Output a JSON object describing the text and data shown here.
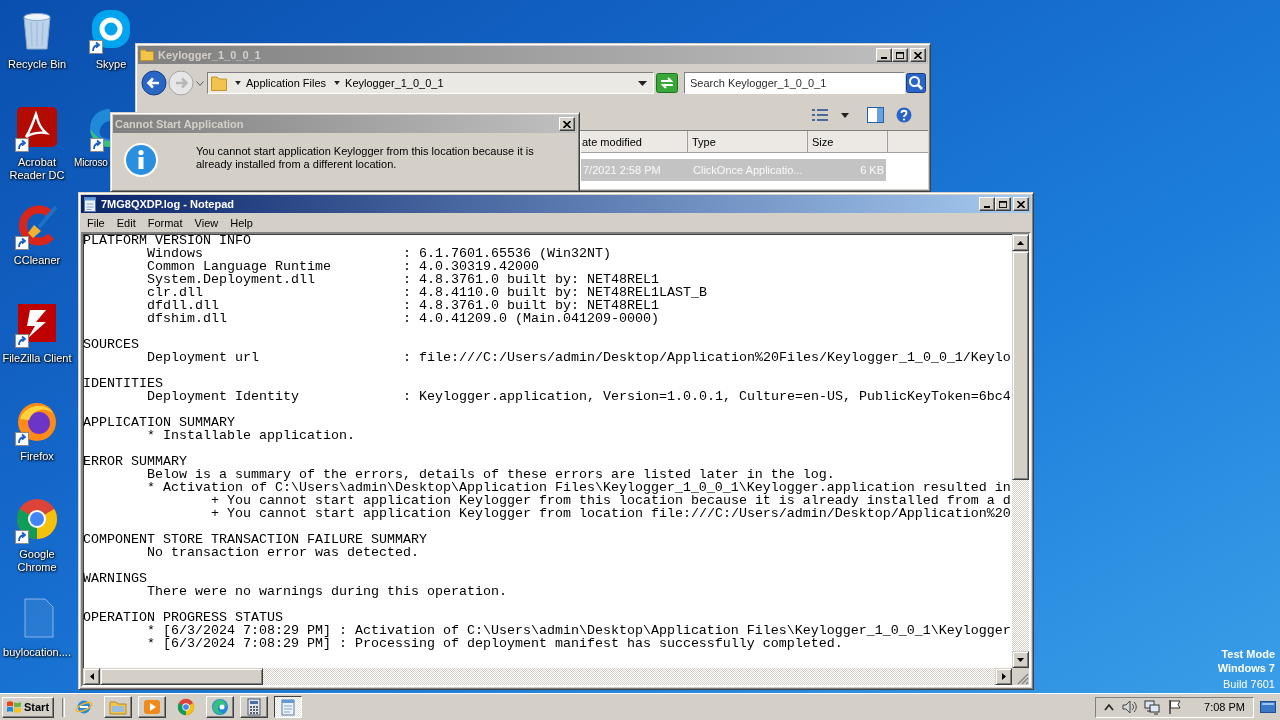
{
  "desktop_icons": [
    {
      "label": "Recycle Bin",
      "shortcut": false
    },
    {
      "label": "Acrobat Reader DC",
      "shortcut": true
    },
    {
      "label": "CCleaner",
      "shortcut": true
    },
    {
      "label": "FileZilla Client",
      "shortcut": true
    },
    {
      "label": "Firefox",
      "shortcut": true
    },
    {
      "label": "Google Chrome",
      "shortcut": true
    },
    {
      "label": "buylocation....",
      "shortcut": false
    },
    {
      "label": "Skype",
      "shortcut": true
    },
    {
      "label": "Microso",
      "shortcut": true
    }
  ],
  "explorer": {
    "title": "Keylogger_1_0_0_1",
    "active": false,
    "breadcrumb": [
      "Application Files",
      "Keylogger_1_0_0_1"
    ],
    "search": {
      "placeholder": "Search Keylogger_1_0_0_1"
    },
    "columns": [
      "ate modified",
      "Type",
      "Size"
    ],
    "rows": [
      {
        "cells": [
          "7/2021 2:58 PM",
          "ClickOnce Applicatio...",
          "6 KB"
        ],
        "selected": true
      }
    ]
  },
  "dialog": {
    "title": "Cannot Start Application",
    "active": false,
    "message": "You cannot start application Keylogger from this location because it is already installed from a different location."
  },
  "notepad": {
    "title": "7MG8QXDP.log - Notepad",
    "active": true,
    "menu": [
      "File",
      "Edit",
      "Format",
      "View",
      "Help"
    ],
    "log": [
      {
        "heading": "PLATFORM VERSION INFO",
        "lines": [
          {
            "kind": "field",
            "label": "Windows",
            "value": ": 6.1.7601.65536 (Win32NT)"
          },
          {
            "kind": "field",
            "label": "Common Language Runtime",
            "value": ": 4.0.30319.42000"
          },
          {
            "kind": "field",
            "label": "System.Deployment.dll",
            "value": ": 4.8.3761.0 built by: NET48REL1"
          },
          {
            "kind": "field",
            "label": "clr.dll",
            "value": ": 4.8.4110.0 built by: NET48REL1LAST_B"
          },
          {
            "kind": "field",
            "label": "dfdll.dll",
            "value": ": 4.8.3761.0 built by: NET48REL1"
          },
          {
            "kind": "field",
            "label": "dfshim.dll",
            "value": ": 4.0.41209.0 (Main.041209-0000)"
          }
        ]
      },
      {
        "heading": "SOURCES",
        "lines": [
          {
            "kind": "field",
            "label": "Deployment url",
            "value": ": file:///C:/Users/admin/Desktop/Application%20Files/Keylogger_1_0_0_1/Keylo"
          }
        ]
      },
      {
        "heading": "IDENTITIES",
        "lines": [
          {
            "kind": "field",
            "label": "Deployment Identity",
            "value": ": Keylogger.application, Version=1.0.0.1, Culture=en-US, PublicKeyToken=6bc4"
          }
        ]
      },
      {
        "heading": "APPLICATION SUMMARY",
        "lines": [
          {
            "kind": "text",
            "text": "* Installable application."
          }
        ]
      },
      {
        "heading": "ERROR SUMMARY",
        "lines": [
          {
            "kind": "text",
            "text": "Below is a summary of the errors, details of these errors are listed later in the log."
          },
          {
            "kind": "text",
            "text": "* Activation of C:\\Users\\admin\\Desktop\\Application Files\\Keylogger_1_0_0_1\\Keylogger.application resulted in",
            "children": [
              {
                "text": "+ You cannot start application Keylogger from this location because it is already installed from a d"
              },
              {
                "text": "+ You cannot start application Keylogger from location file:///C:/Users/admin/Desktop/Application%20"
              }
            ]
          }
        ]
      },
      {
        "heading": "COMPONENT STORE TRANSACTION FAILURE SUMMARY",
        "lines": [
          {
            "kind": "text",
            "text": "No transaction error was detected."
          }
        ]
      },
      {
        "heading": "WARNINGS",
        "lines": [
          {
            "kind": "text",
            "text": "There were no warnings during this operation."
          }
        ]
      },
      {
        "heading": "OPERATION PROGRESS STATUS",
        "lines": [
          {
            "kind": "text",
            "text": "* [6/3/2024 7:08:29 PM] : Activation of C:\\Users\\admin\\Desktop\\Application Files\\Keylogger_1_0_0_1\\Keylogger"
          },
          {
            "kind": "text",
            "text": "* [6/3/2024 7:08:29 PM] : Processing of deployment manifest has successfully completed."
          }
        ]
      }
    ]
  },
  "desktop_notice": [
    "Test Mode",
    "Windows 7",
    "Build 7601"
  ],
  "taskbar": {
    "start": "Start",
    "items": [
      {
        "open": false,
        "selected": false
      },
      {
        "open": true,
        "selected": false
      },
      {
        "open": true,
        "selected": false
      },
      {
        "open": false,
        "selected": false
      },
      {
        "open": true,
        "selected": false
      },
      {
        "open": true,
        "selected": false
      },
      {
        "selected": true
      }
    ],
    "clock": "7:08 PM"
  }
}
